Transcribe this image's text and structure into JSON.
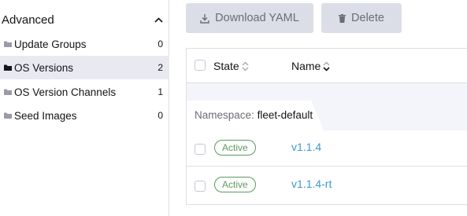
{
  "sidebar": {
    "header": "Advanced",
    "header_icon": "chevron-up-icon",
    "items": [
      {
        "label": "Update Groups",
        "count": "0",
        "icon": "folder-icon",
        "active": false
      },
      {
        "label": "OS Versions",
        "count": "2",
        "icon": "folder-icon",
        "active": true
      },
      {
        "label": "OS Version Channels",
        "count": "1",
        "icon": "folder-icon",
        "active": false
      },
      {
        "label": "Seed Images",
        "count": "0",
        "icon": "folder-icon",
        "active": false
      }
    ]
  },
  "toolbar": {
    "download_label": "Download YAML",
    "download_icon": "download-icon",
    "delete_label": "Delete",
    "delete_icon": "trash-icon"
  },
  "table": {
    "columns": [
      "State",
      "Name"
    ],
    "group": {
      "key": "Namespace:",
      "value": "fleet-default"
    },
    "rows": [
      {
        "state": "Active",
        "name": "v1.1.4"
      },
      {
        "state": "Active",
        "name": "v1.1.4-rt"
      }
    ]
  },
  "colors": {
    "active_bg": "#e9eaf1",
    "button_bg": "#dcdee7",
    "link": "#3d98d3",
    "success": "#5d995d"
  }
}
